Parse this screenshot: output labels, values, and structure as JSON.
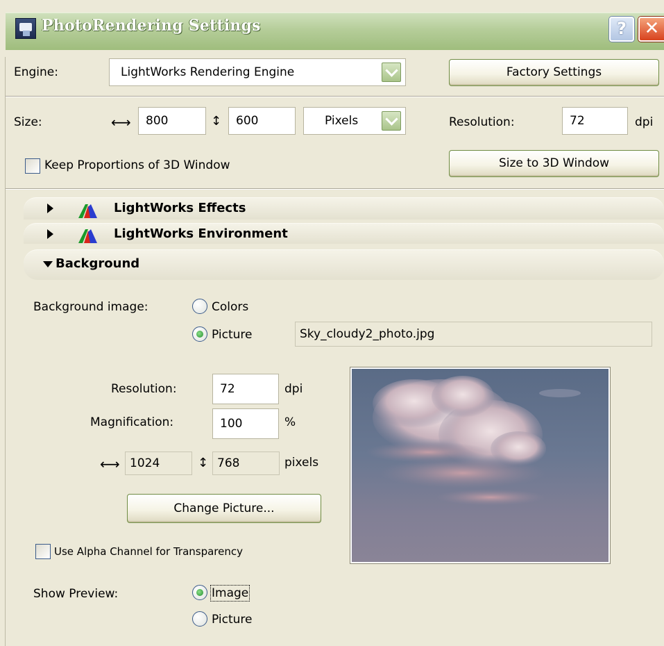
{
  "window": {
    "title": "PhotoRendering Settings",
    "help_label": "?",
    "close_label": "✕"
  },
  "engine": {
    "label": "Engine:",
    "value": "LightWorks Rendering Engine",
    "factory_button": "Factory Settings"
  },
  "size": {
    "label": "Size:",
    "width_icon": "horizontal-arrows",
    "width": "800",
    "height_icon": "vertical-arrows",
    "height": "600",
    "unit": "Pixels",
    "resolution_label": "Resolution:",
    "resolution": "72",
    "resolution_unit": "dpi",
    "keep_proportions_label": "Keep Proportions of 3D Window",
    "keep_proportions_checked": false,
    "size_to_window_button": "Size to 3D Window"
  },
  "sections": [
    {
      "title": "LightWorks Effects",
      "expanded": false
    },
    {
      "title": "LightWorks Environment",
      "expanded": false
    },
    {
      "title": "Background",
      "expanded": true
    }
  ],
  "background": {
    "image_label": "Background image:",
    "options": [
      "Colors",
      "Picture"
    ],
    "selected": "Picture",
    "picture_file": "Sky_cloudy2_photo.jpg",
    "resolution_label": "Resolution:",
    "resolution": "72",
    "resolution_unit": "dpi",
    "magnification_label": "Magnification:",
    "magnification": "100",
    "magnification_unit": "%",
    "pixel_width": "1024",
    "pixel_height": "768",
    "pixel_unit": "pixels",
    "change_picture_button": "Change Picture...",
    "alpha_label": "Use Alpha Channel for Transparency",
    "alpha_checked": false,
    "show_preview_label": "Show Preview:",
    "preview_options": [
      "Image",
      "Picture"
    ],
    "preview_selected": "Image"
  },
  "colors": {
    "titlebar": "#9fbd7d",
    "dialog_bg": "#ECE9D8",
    "close_button": "#d8431e"
  }
}
